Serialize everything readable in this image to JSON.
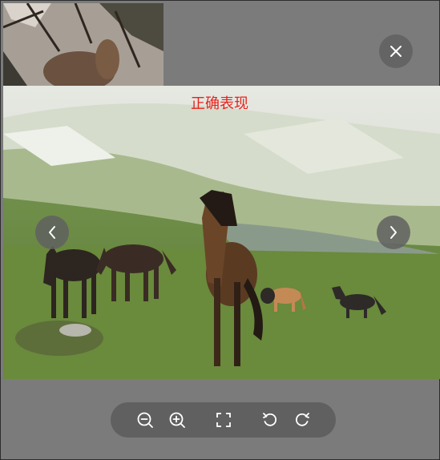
{
  "viewer": {
    "caption": "正确表现",
    "icons": {
      "close": "close-icon",
      "prev": "chevron-left-icon",
      "next": "chevron-right-icon",
      "zoom_out": "zoom-out-icon",
      "zoom_in": "zoom-in-icon",
      "fullscreen": "fullscreen-icon",
      "rotate_left": "rotate-left-icon",
      "rotate_right": "rotate-right-icon"
    },
    "colors": {
      "backdrop": "#7b7b7b",
      "button_bg": "#606060",
      "icon": "#ffffff",
      "caption": "#e8221d"
    }
  }
}
